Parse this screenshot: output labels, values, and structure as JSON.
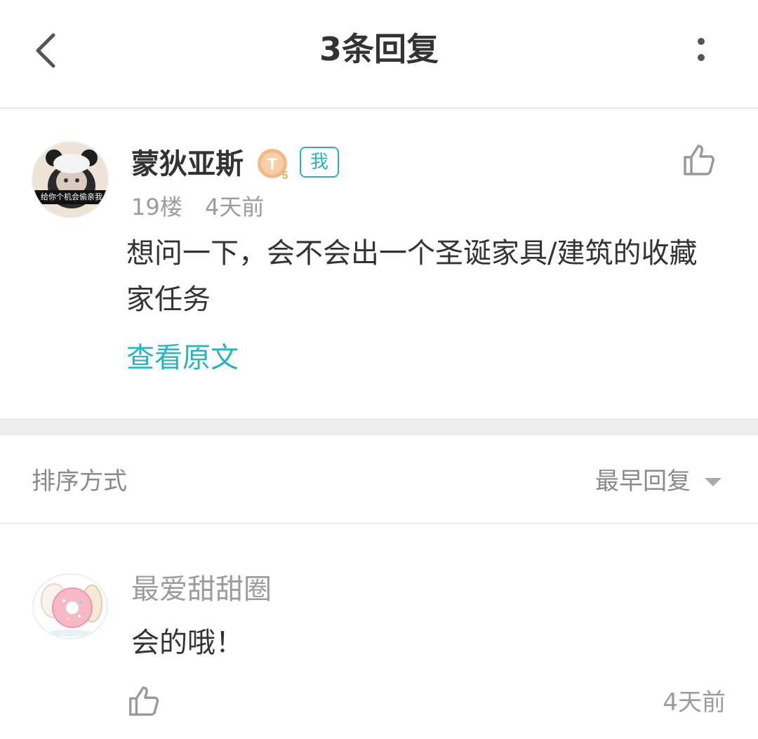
{
  "header": {
    "title": "3条回复",
    "back_icon": "chevron-left-icon",
    "more_icon": "more-vertical-icon"
  },
  "post": {
    "author": "蒙狄亚斯",
    "avatar_caption": "给你个机会偷亲我",
    "level_badge": "T5",
    "me_tag": "我",
    "floor": "19楼",
    "time": "4天前",
    "content": "想问一下，会不会出一个圣诞家具/建筑的收藏家任务",
    "view_original": "查看原文",
    "like_icon": "thumbs-up-icon"
  },
  "sort": {
    "label": "排序方式",
    "value": "最早回复"
  },
  "replies": [
    {
      "author": "最爱甜甜圈",
      "content": "会的哦！",
      "time": "4天前",
      "like_icon": "thumbs-up-icon"
    }
  ],
  "colors": {
    "accent": "#2bb3c0",
    "text": "#333333",
    "muted": "#9c9c9c",
    "divider": "#ededed"
  }
}
